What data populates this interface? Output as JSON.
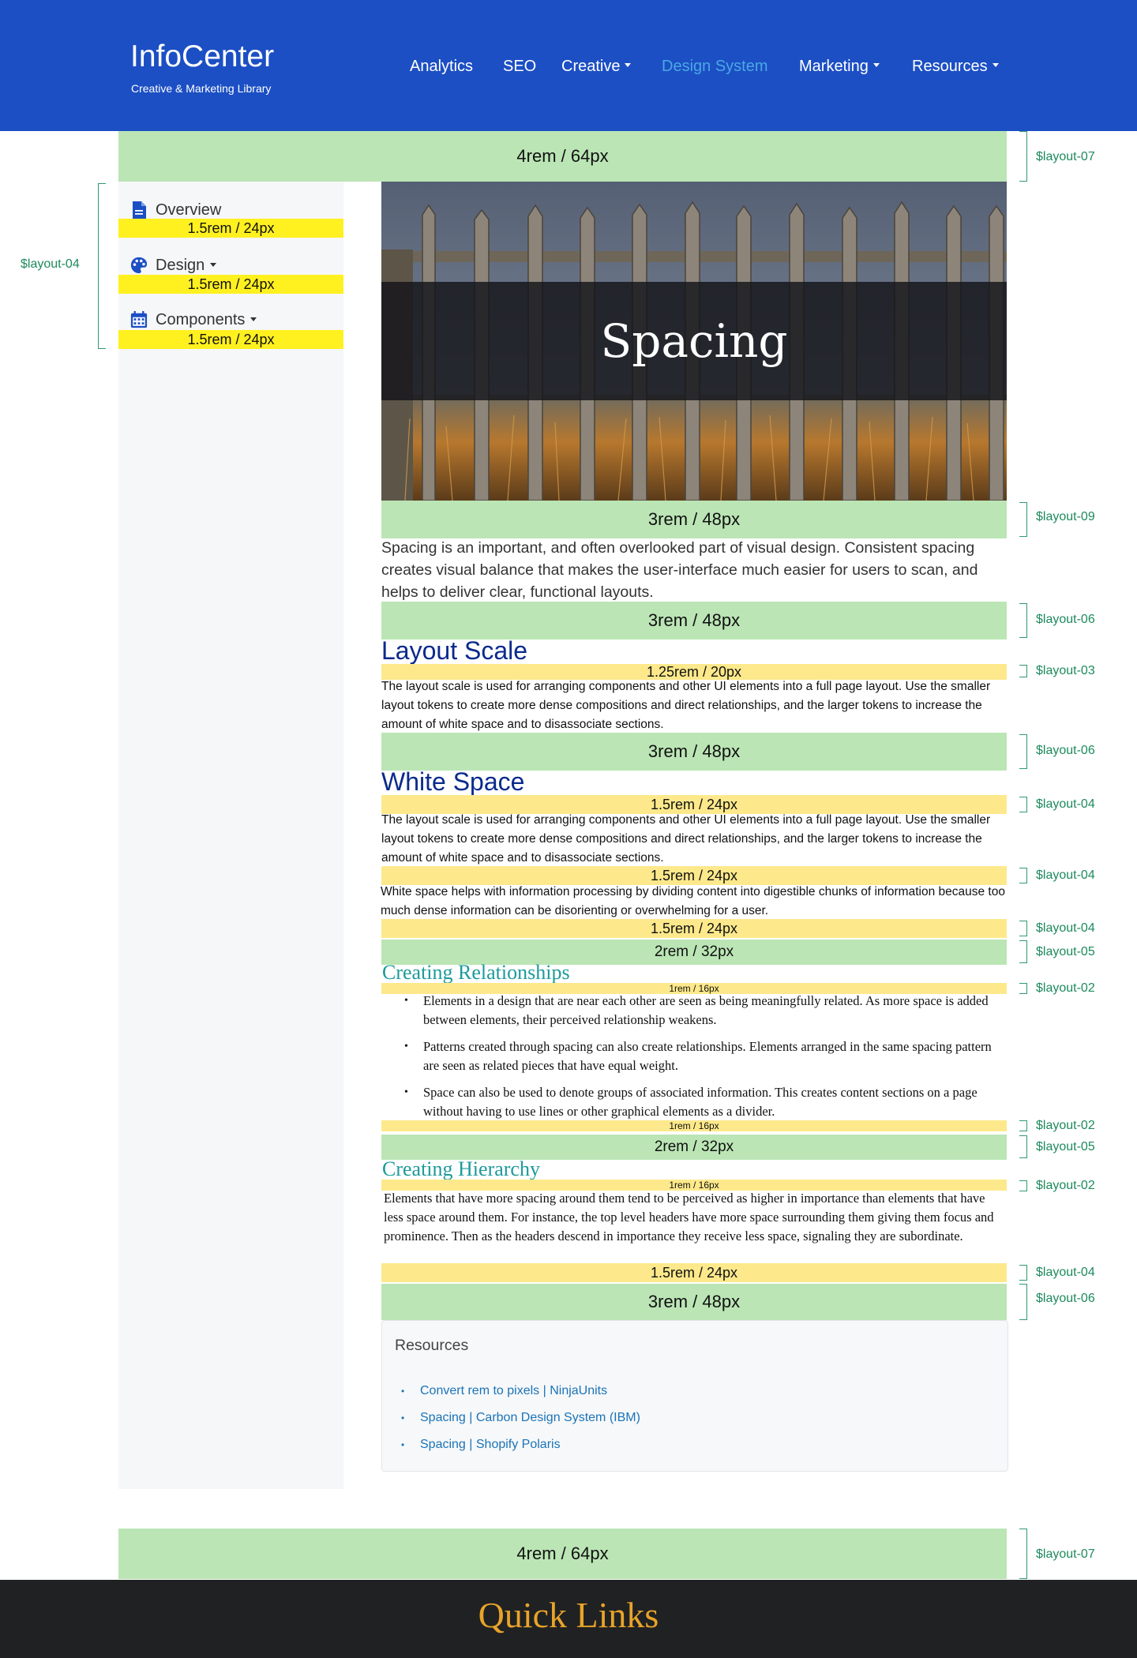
{
  "header": {
    "brand_title": "InfoCenter",
    "brand_subtitle": "Creative & Marketing Library",
    "nav": [
      {
        "label": "Analytics",
        "dropdown": false,
        "active": false
      },
      {
        "label": "SEO",
        "dropdown": false,
        "active": false
      },
      {
        "label": "Creative",
        "dropdown": true,
        "active": false
      },
      {
        "label": "Design System",
        "dropdown": false,
        "active": true
      },
      {
        "label": "Marketing",
        "dropdown": true,
        "active": false
      },
      {
        "label": "Resources",
        "dropdown": true,
        "active": false
      }
    ],
    "background_color": "#1c4fc4",
    "active_color": "#4aa8e4"
  },
  "sidebar": {
    "items": [
      {
        "label": "Overview",
        "icon": "document-icon",
        "dropdown": false,
        "spacer": "1.5rem / 24px"
      },
      {
        "label": "Design",
        "icon": "palette-icon",
        "dropdown": true,
        "spacer": "1.5rem / 24px"
      },
      {
        "label": "Components",
        "icon": "calendar-icon",
        "dropdown": true,
        "spacer": "1.5rem / 24px"
      }
    ],
    "layout_label": "$layout-04"
  },
  "hero": {
    "title": "Spacing"
  },
  "spacers": {
    "top": "4rem / 64px",
    "after_hero": "3rem / 48px",
    "after_intro": "3rem / 48px",
    "after_layout_scale_title": "1.25rem / 20px",
    "after_layout_scale": "3rem / 48px",
    "after_white_space_title": "1.5rem / 24px",
    "after_white_space_p1": "1.5rem / 24px",
    "after_white_space_p2": "1.5rem / 24px",
    "before_relationships": "2rem / 32px",
    "after_relationships_title": "1rem / 16px",
    "after_relationships_list": "1rem / 16px",
    "before_hierarchy": "2rem / 32px",
    "after_hierarchy_title": "1rem / 16px",
    "after_hierarchy": "1.5rem / 24px",
    "before_resources": "3rem / 48px",
    "bottom": "4rem / 64px"
  },
  "layout_labels": {
    "top": "$layout-07",
    "after_hero": "$layout-09",
    "after_intro": "$layout-06",
    "after_layout_scale_title": "$layout-03",
    "after_layout_scale": "$layout-06",
    "after_white_space_title": "$layout-04",
    "after_white_space_p1": "$layout-04",
    "after_white_space_p2": "$layout-04",
    "before_relationships": "$layout-05",
    "after_relationships_title": "$layout-02",
    "after_relationships_list": "$layout-02",
    "before_hierarchy": "$layout-05",
    "after_hierarchy_title": "$layout-02",
    "after_hierarchy": "$layout-04",
    "before_resources": "$layout-06",
    "bottom": "$layout-07"
  },
  "content": {
    "intro": "Spacing is an important, and often overlooked part of visual design. Consistent spacing creates visual balance that makes the user-interface much easier for users to scan, and helps to deliver clear, functional layouts.",
    "layout_scale_title": "Layout Scale",
    "layout_scale_body": "The layout scale is used for arranging components and other UI elements into a full page layout. Use the smaller layout tokens to create more dense compositions and direct relationships, and the larger tokens to increase the amount of white space and to disassociate sections.",
    "white_space_title": "White Space",
    "white_space_body1": "The layout scale is used for arranging components and other UI elements into a full page layout. Use the smaller layout tokens to create more dense compositions and direct relationships, and the larger tokens to increase the amount of white space and to disassociate sections.",
    "white_space_body2": "White space helps with information processing by dividing content into digestible chunks of information because too much dense information can be disorienting or overwhelming for a user.",
    "relationships_title": "Creating Relationships",
    "relationships_items": [
      "Elements in a design that are near each other are seen as being meaningfully related. As more space is added between elements, their perceived relationship weakens.",
      "Patterns created through spacing can also create relationships. Elements arranged in the same spacing pattern are seen as related pieces that have equal weight.",
      "Space can also be used to denote groups of associated information. This creates content sections on a page without having to use lines or other graphical elements as a divider."
    ],
    "hierarchy_title": "Creating Hierarchy",
    "hierarchy_body": "Elements that have more spacing around them tend to be perceived as higher in importance than elements that have less space around them. For instance, the top level headers have more space surrounding them giving them focus and prominence. Then as the headers descend in importance they receive less space, signaling they are subordinate."
  },
  "resources": {
    "title": "Resources",
    "links": [
      "Convert rem to pixels | NinjaUnits",
      "Spacing | Carbon Design System (IBM)",
      "Spacing | Shopify Polaris"
    ]
  },
  "footer": {
    "title": "Quick Links"
  }
}
